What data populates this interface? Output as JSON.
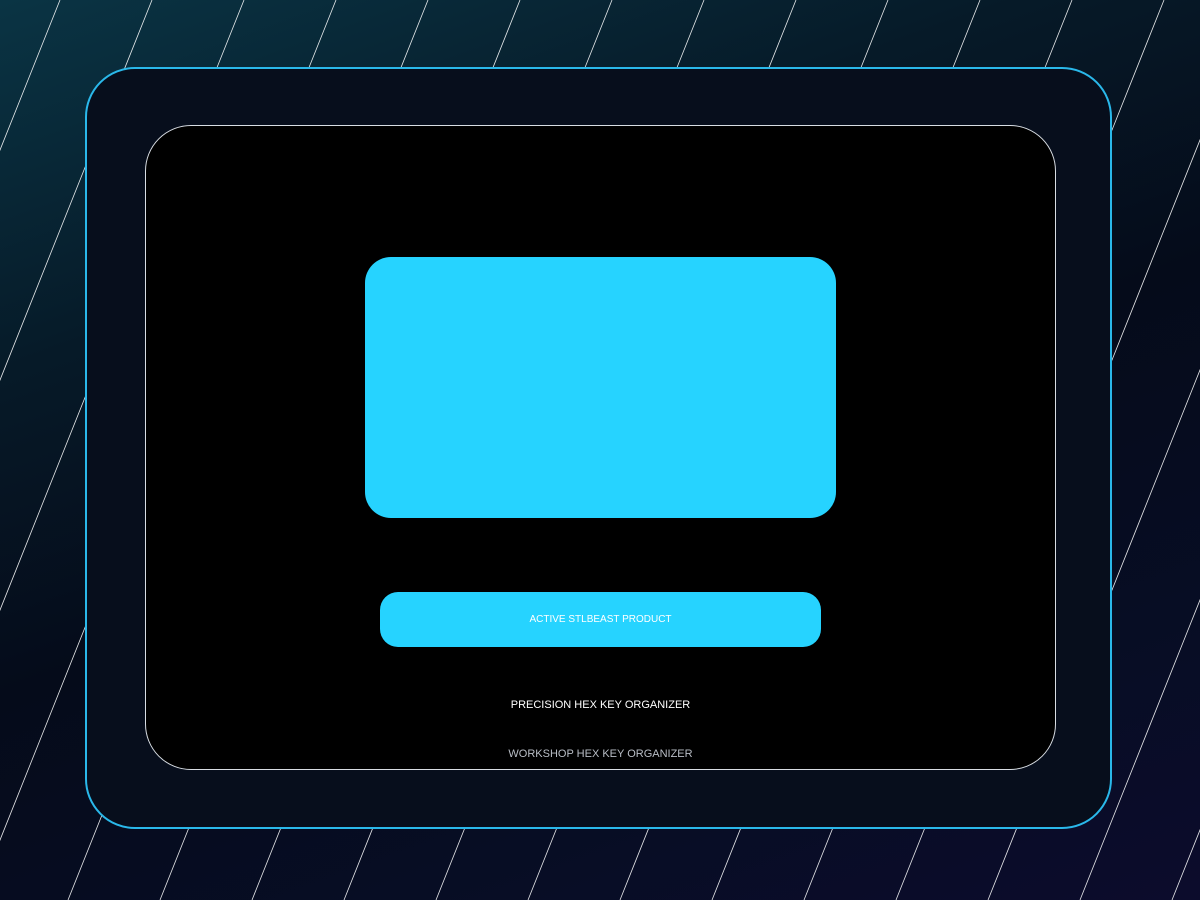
{
  "product_card": {
    "badge_label": "ACTIVE STLBEAST PRODUCT",
    "title": "PRECISION HEX KEY ORGANIZER",
    "subtitle": "WORKSHOP HEX KEY ORGANIZER"
  },
  "colors": {
    "accent": "#26d3ff",
    "frame_border": "#2ab8ea",
    "frame_fill": "#070e1c",
    "screen_fill": "#000000",
    "stripe": "#ffffff"
  }
}
